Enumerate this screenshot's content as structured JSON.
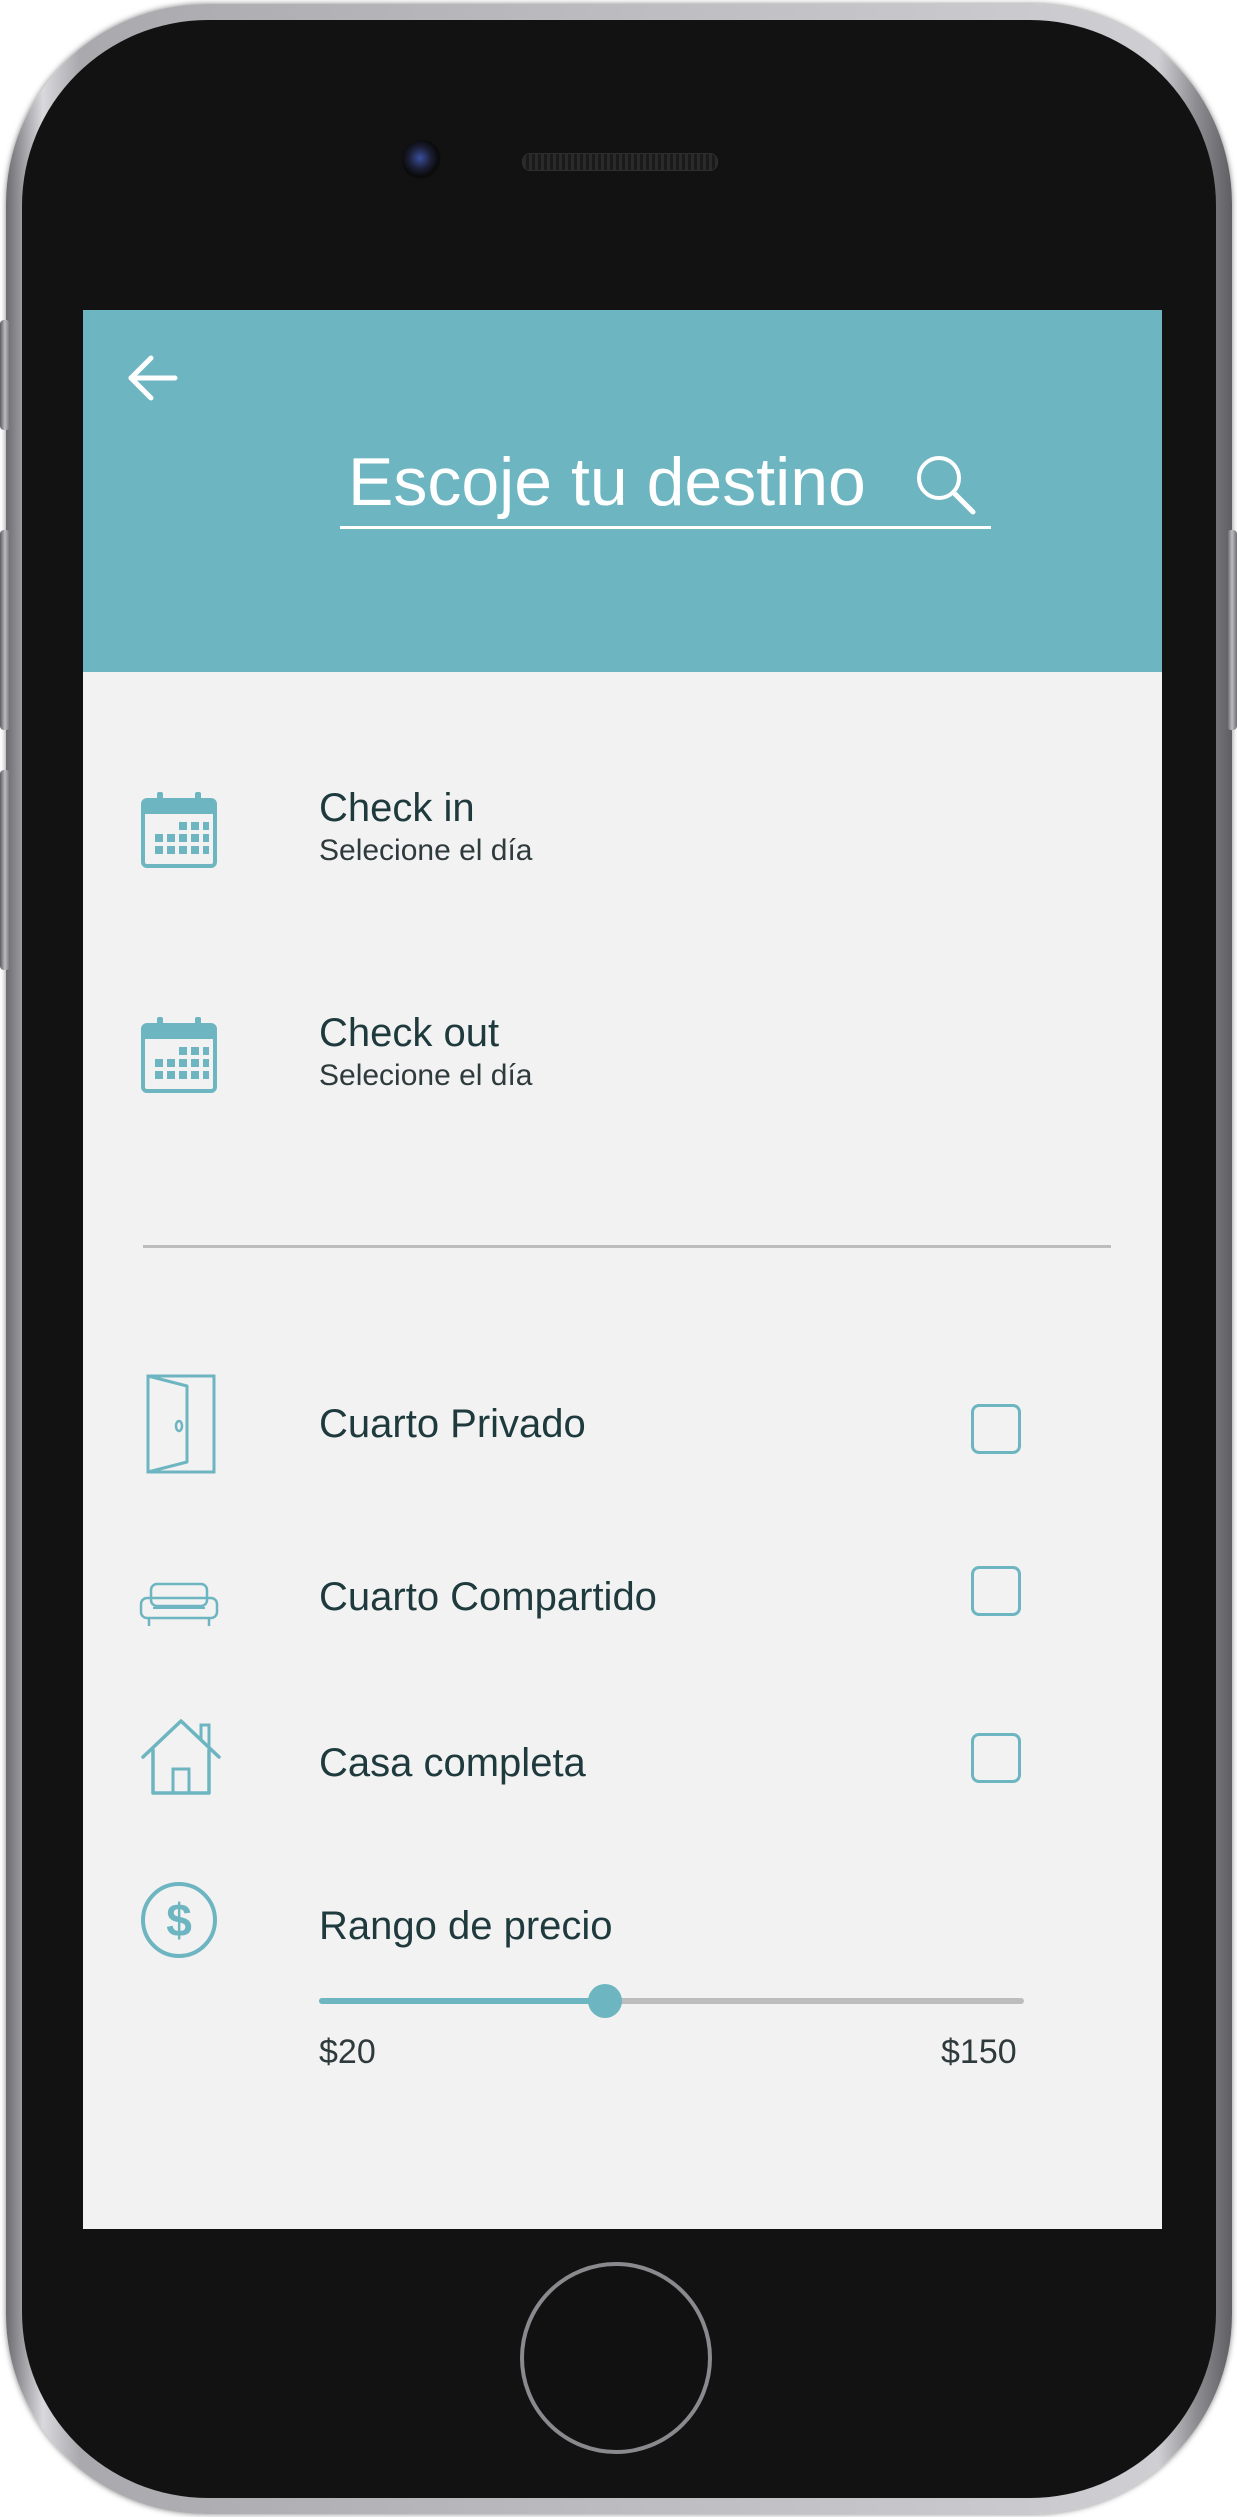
{
  "header": {
    "search_placeholder": "Escoje tu destino",
    "back_icon": "arrow-left-icon",
    "search_icon": "search-icon"
  },
  "dates": [
    {
      "icon": "calendar-icon",
      "label": "Check in",
      "sublabel": "Selecione el día"
    },
    {
      "icon": "calendar-icon",
      "label": "Check out",
      "sublabel": "Selecione el día"
    }
  ],
  "room_types": [
    {
      "icon": "door-icon",
      "label": "Cuarto Privado",
      "checked": false
    },
    {
      "icon": "sofa-icon",
      "label": "Cuarto Compartido",
      "checked": false
    },
    {
      "icon": "house-icon",
      "label": "Casa completa",
      "checked": false
    }
  ],
  "price": {
    "icon": "dollar-icon",
    "label": "Rango de precio",
    "min_label": "$20",
    "max_label": "$150",
    "slider_fraction": 0.405
  },
  "colors": {
    "accent": "#6db5c1",
    "background": "#f2f2f2",
    "text": "#1f3a3d"
  }
}
